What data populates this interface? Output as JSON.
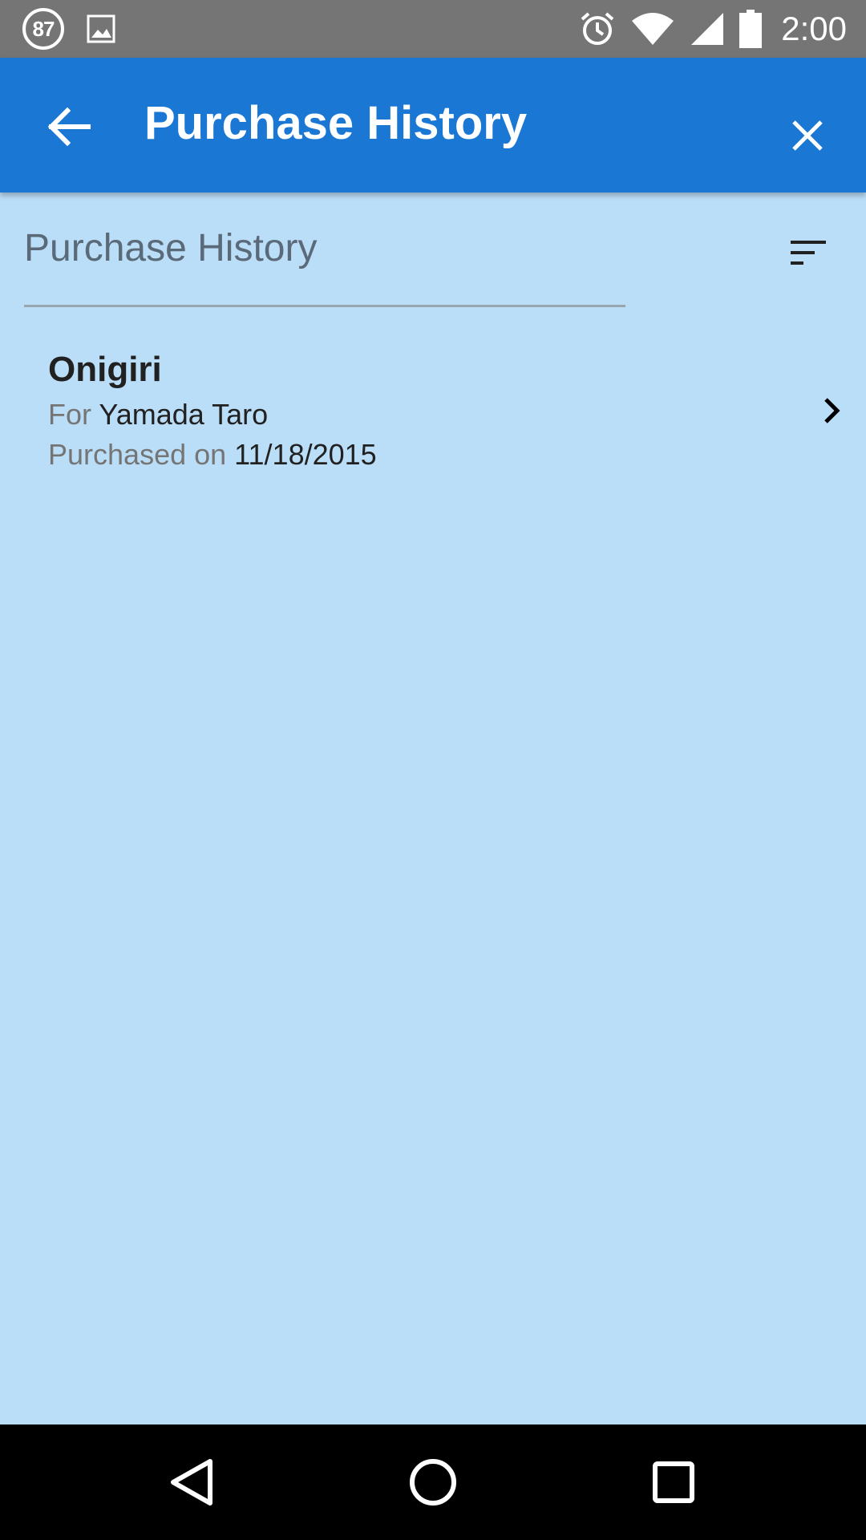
{
  "status_bar": {
    "notification_count": "87",
    "time": "2:00",
    "icons": [
      "image-icon",
      "alarm-icon",
      "wifi-icon",
      "signal-icon",
      "battery-icon"
    ]
  },
  "app_bar": {
    "title": "Purchase History",
    "back_icon": "arrow-back-icon",
    "close_icon": "close-icon",
    "color": "#1a77d4"
  },
  "section": {
    "title": "Purchase History",
    "sort_icon": "sort-icon"
  },
  "purchases": [
    {
      "name": "Onigiri",
      "for_label": "For",
      "for_value": "Yamada Taro",
      "date_label": "Purchased on",
      "date_value": "11/18/2015"
    }
  ],
  "nav_bar": {
    "buttons": [
      "back-triangle-icon",
      "home-circle-icon",
      "recents-square-icon"
    ]
  },
  "colors": {
    "background": "#bbdef8",
    "status_bar": "#757575",
    "app_bar": "#1a77d4"
  }
}
